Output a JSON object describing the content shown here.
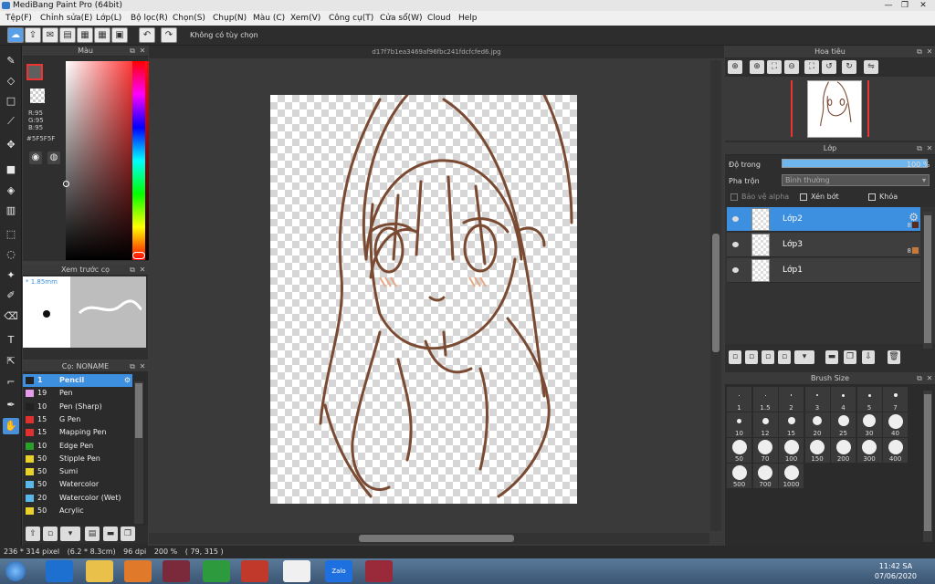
{
  "window": {
    "title": "MediBang Paint Pro (64bit)",
    "minimize": "—",
    "maximize": "❐",
    "close": "✕"
  },
  "menu": [
    "Tệp(F)",
    "Chỉnh sửa(E)",
    "Lớp(L)",
    "Bộ lọc(R)",
    "Chọn(S)",
    "Chụp(N)",
    "Màu (C)",
    "Xem(V)",
    "Công cụ(T)",
    "Cửa sổ(W)",
    "Cloud",
    "Help"
  ],
  "toolbar": {
    "selection_hint": "Không có tùy chọn"
  },
  "color_panel": {
    "title": "Màu",
    "r": "R:95",
    "g": "G:95",
    "b": "B:95",
    "hex": "#5F5F5F",
    "foreground_color": "#5F5F5F"
  },
  "brush_preview": {
    "title": "Xem trước cọ",
    "size": "* 1.85mm"
  },
  "brush_panel": {
    "title": "Cọ: NONAME",
    "brushes": [
      {
        "size": "1",
        "name": "Pencil",
        "color": "#222222",
        "active": true
      },
      {
        "size": "19",
        "name": "Pen",
        "color": "#e79ae8"
      },
      {
        "size": "10",
        "name": "Pen (Sharp)",
        "color": "#222222"
      },
      {
        "size": "15",
        "name": "G Pen",
        "color": "#e03030"
      },
      {
        "size": "15",
        "name": "Mapping Pen",
        "color": "#e03030"
      },
      {
        "size": "10",
        "name": "Edge Pen",
        "color": "#2aa02a"
      },
      {
        "size": "50",
        "name": "Stipple Pen",
        "color": "#e8d22a"
      },
      {
        "size": "50",
        "name": "Sumi",
        "color": "#e8d22a"
      },
      {
        "size": "50",
        "name": "Watercolor",
        "color": "#5ab8e8"
      },
      {
        "size": "20",
        "name": "Watercolor (Wet)",
        "color": "#5ab8e8"
      },
      {
        "size": "50",
        "name": "Acrylic",
        "color": "#e8d22a"
      }
    ]
  },
  "canvas": {
    "document_title": "d17f7b1ea3469af96fbc241fdcfcfed6.jpg"
  },
  "navigator": {
    "title": "Hoa tiêu"
  },
  "layers": {
    "title": "Lớp",
    "opacity_label": "Độ trong",
    "opacity_value": "100 %",
    "opacity_fraction": 1.0,
    "blend_label": "Pha trộn",
    "blend_value": "Bình thường",
    "protect_alpha": "Bảo vệ alpha",
    "clipping": "Xén bớt",
    "lock": "Khóa",
    "items": [
      {
        "name": "Lớp2",
        "active": true,
        "bit": "8"
      },
      {
        "name": "Lớp3",
        "active": false,
        "bit": "8"
      },
      {
        "name": "Lớp1",
        "active": false,
        "bit": ""
      }
    ]
  },
  "brush_size": {
    "title": "Brush Size",
    "sizes": [
      "1",
      "1.5",
      "2",
      "3",
      "4",
      "5",
      "7",
      "10",
      "12",
      "15",
      "20",
      "25",
      "30",
      "40",
      "50",
      "70",
      "100",
      "150",
      "200",
      "300",
      "400",
      "500",
      "700",
      "1000"
    ]
  },
  "status": {
    "dimensions": "236 * 314 pixel",
    "physical": "(6.2 * 8.3cm)",
    "dpi": "96 dpi",
    "zoom": "200 %",
    "cursor": "( 79, 315 )"
  },
  "taskbar": {
    "zalo": "Zalo",
    "time": "11:42 SA",
    "date": "07/06/2020"
  }
}
